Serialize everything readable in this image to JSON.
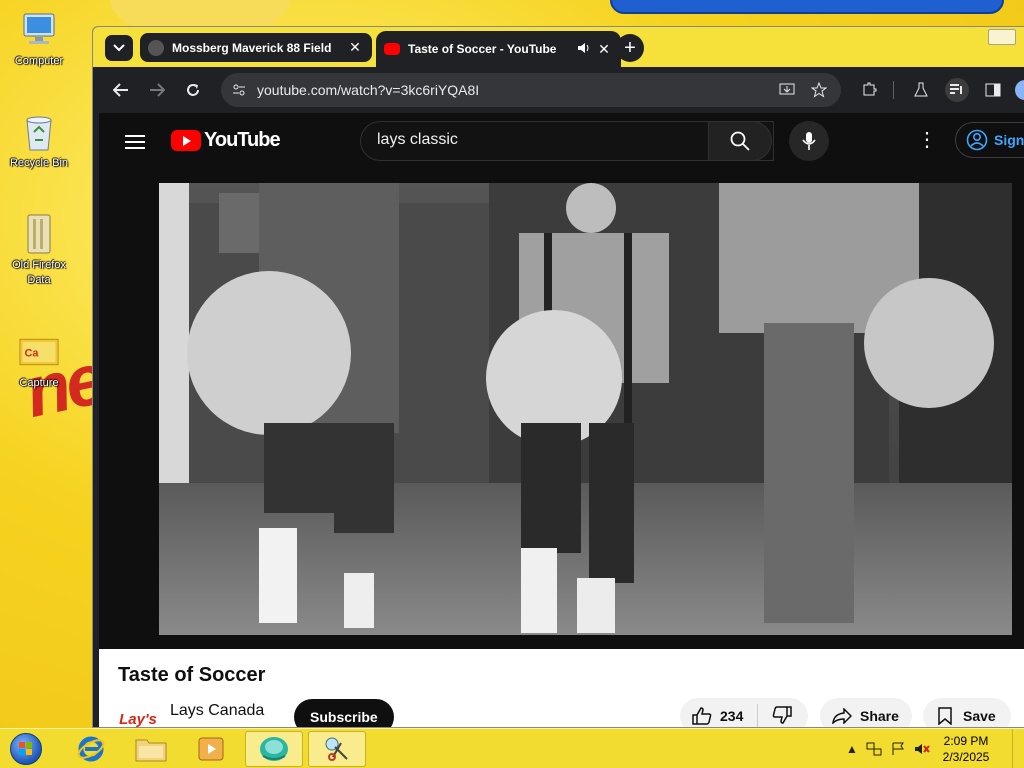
{
  "desktop": {
    "icons": [
      {
        "label": "Computer",
        "icon": "computer-icon"
      },
      {
        "label": "Recycle Bin",
        "icon": "recycle-bin-icon"
      },
      {
        "label": "Old Firefox Data",
        "icon": "folder-icon"
      },
      {
        "label": "Capture",
        "icon": "image-file-icon"
      }
    ]
  },
  "browser": {
    "tabs": [
      {
        "title": "Mossberg Maverick 88 Field",
        "close": "✕",
        "active": false
      },
      {
        "title": "Taste of Soccer - YouTube",
        "close": "✕",
        "active": true,
        "audio": true
      }
    ],
    "new_tab": "+",
    "url": "youtube.com/watch?v=3kc6riYQA8I"
  },
  "youtube": {
    "logo_text": "YouTube",
    "search_value": "lays classic",
    "signin_label": "Sign",
    "video_title": "Taste of Soccer",
    "channel_name": "Lays Canada",
    "channel_avatar_text": "Lay's",
    "subscribe_label": "Subscribe",
    "like_count": "234",
    "share_label": "Share",
    "save_label": "Save"
  },
  "taskbar": {
    "time": "2:09 PM",
    "date": "2/3/2025"
  },
  "colors": {
    "youtube_red": "#ff0000",
    "chrome_dark": "#202124",
    "desktop_yellow": "#f6d320"
  }
}
